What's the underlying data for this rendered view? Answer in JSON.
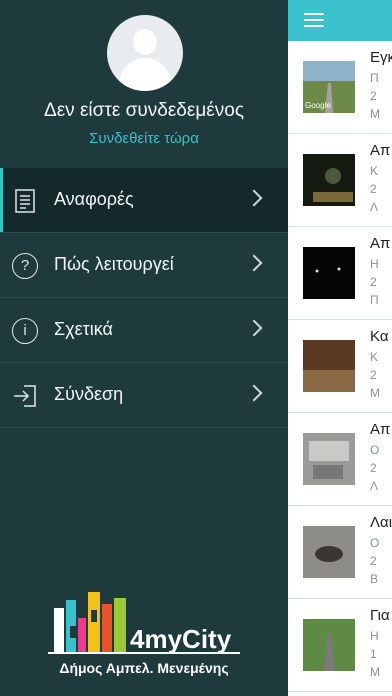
{
  "drawer": {
    "status_text": "Δεν είστε συνδεδεμένος",
    "login_link": "Συνδεθείτε τώρα",
    "menu": [
      {
        "label": "Αναφορές",
        "icon": "document-icon",
        "active": true
      },
      {
        "label": "Πώς λειτουργεί",
        "icon": "question-icon",
        "active": false
      },
      {
        "label": "Σχετικά",
        "icon": "info-icon",
        "active": false
      },
      {
        "label": "Σύνδεση",
        "icon": "login-icon",
        "active": false
      }
    ],
    "logo_text": "4myCity",
    "logo_subtitle": "Δήμος Αμπελ. Μενεμένης"
  },
  "reports": [
    {
      "title": "Εγκ",
      "m1": "Π",
      "m2": "2",
      "m3": "Μ",
      "thumb_label": "Google"
    },
    {
      "title": "Απ",
      "m1": "Κ",
      "m2": "2",
      "m3": "Λ"
    },
    {
      "title": "Απ",
      "m1": "Η",
      "m2": "2",
      "m3": "Π"
    },
    {
      "title": "Κα",
      "m1": "Κ",
      "m2": "2",
      "m3": "Μ"
    },
    {
      "title": "Απ",
      "m1": "Ο",
      "m2": "2",
      "m3": "Λ"
    },
    {
      "title": "Λαι",
      "m1": "Ο",
      "m2": "2",
      "m3": "Β"
    },
    {
      "title": "Για",
      "m1": "Η",
      "m2": "1",
      "m3": "Μ"
    }
  ],
  "colors": {
    "accent": "#3cc2cc",
    "drawer_bg": "#1e3a3d"
  }
}
